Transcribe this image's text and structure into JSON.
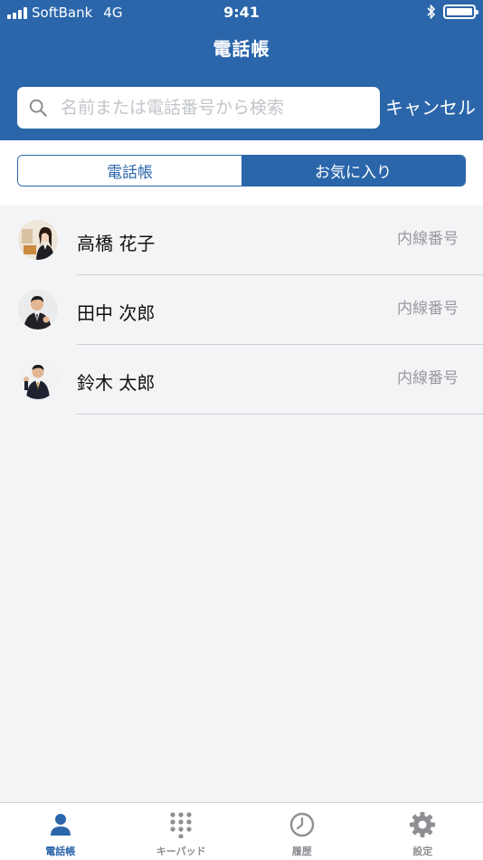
{
  "status_bar": {
    "carrier": "SoftBank",
    "network": "4G",
    "time": "9:41",
    "battery_level": 1.0
  },
  "header": {
    "title": "電話帳"
  },
  "search": {
    "placeholder": "名前または電話番号から検索",
    "value": "",
    "cancel_label": "キャンセル"
  },
  "segment": {
    "left_label": "電話帳",
    "right_label": "お気に入り",
    "selected": "お気に入り"
  },
  "contacts": [
    {
      "name": "高橋 花子",
      "ext_label": "内線番号"
    },
    {
      "name": "田中 次郎",
      "ext_label": "内線番号"
    },
    {
      "name": "鈴木 太郎",
      "ext_label": "内線番号"
    }
  ],
  "tabbar": {
    "items": [
      {
        "label": "電話帳",
        "icon": "person-icon",
        "active": true
      },
      {
        "label": "キーパッド",
        "icon": "keypad-icon",
        "active": false
      },
      {
        "label": "履歴",
        "icon": "clock-icon",
        "active": false
      },
      {
        "label": "設定",
        "icon": "gear-icon",
        "active": false
      }
    ]
  },
  "colors": {
    "brand": "#2b66aa",
    "background": "#f3f4f6",
    "inactive_tab": "#8e8e93"
  }
}
